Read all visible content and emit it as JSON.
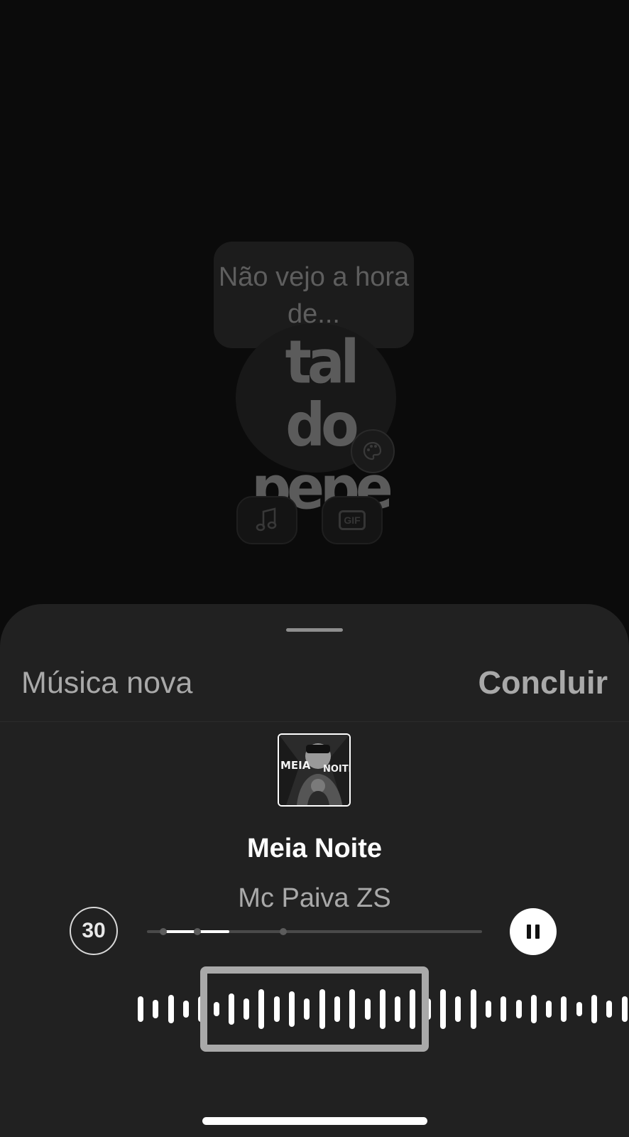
{
  "background": {
    "prompt_text": "Não vejo a hora de...",
    "sticker_text_line1": "tal do",
    "sticker_text_line2": "pepe",
    "music_icon": "music-note-icon",
    "gif_label": "GIF"
  },
  "sheet": {
    "title": "Música nova",
    "done_label": "Concluir"
  },
  "song": {
    "title": "Meia Noite",
    "artist": "Mc Paiva ZS",
    "album_art_text_left": "MEIA",
    "album_art_text_right": "NOITE"
  },
  "player": {
    "duration_label": "30",
    "progress": 0.2,
    "state": "playing",
    "pause_icon": "pause-icon"
  },
  "colors": {
    "sheet_bg": "#212121",
    "accent": "#ffffff",
    "muted_text": "#a9a9a9"
  }
}
